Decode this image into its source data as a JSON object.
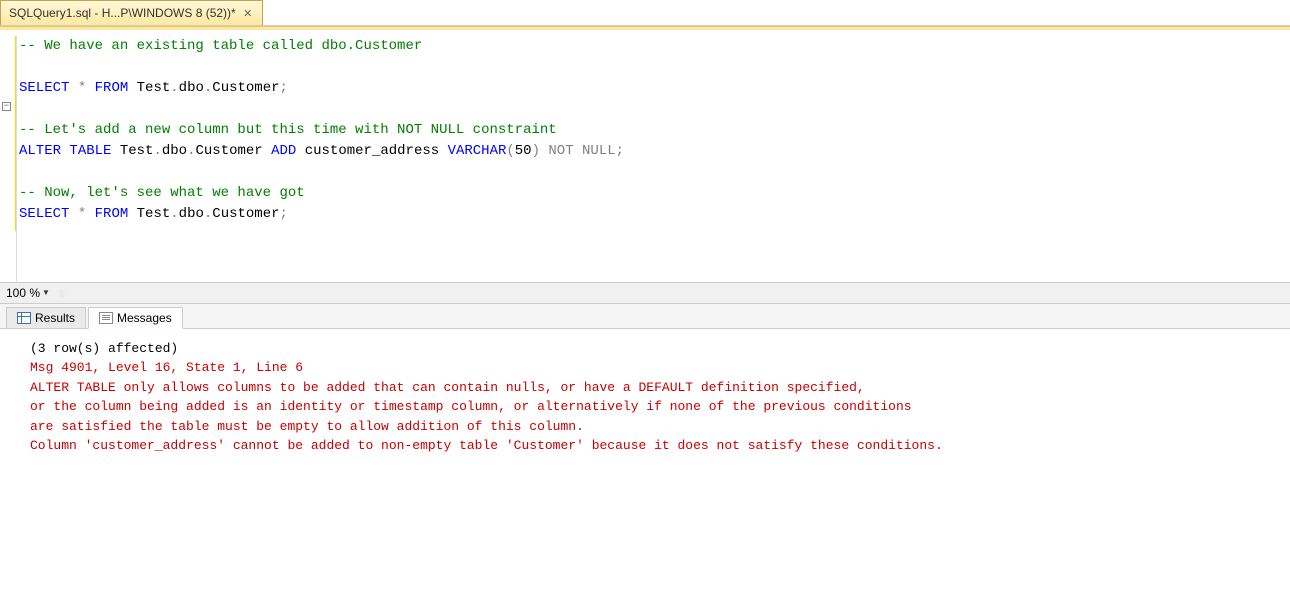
{
  "tab": {
    "title": "SQLQuery1.sql - H...P\\WINDOWS 8 (52))*"
  },
  "editor": {
    "lines": [
      {
        "type": "comment",
        "text": "-- We have an existing table called dbo.Customer"
      },
      {
        "type": "blank",
        "text": ""
      },
      {
        "type": "sql1_a",
        "kw1": "SELECT",
        "star": " * ",
        "kw2": "FROM",
        "rest": " Test",
        "dot1": ".",
        "rest2": "dbo",
        "dot2": ".",
        "rest3": "Customer",
        "semi": ";"
      },
      {
        "type": "blank",
        "text": ""
      },
      {
        "type": "comment",
        "text": "-- Let's add a new column but this time with NOT NULL constraint"
      },
      {
        "type": "alter",
        "kw1": "ALTER",
        "sp1": " ",
        "kw2": "TABLE",
        "rest1": " Test",
        "d1": ".",
        "rest2": "dbo",
        "d2": ".",
        "rest3": "Customer ",
        "kw3": "ADD",
        "rest4": " customer_address ",
        "kw4": "VARCHAR",
        "paren1": "(",
        "num": "50",
        "paren2": ")",
        "sp2": " ",
        "gray1": "NOT",
        "sp3": " ",
        "gray2": "NULL",
        "semi": ";"
      },
      {
        "type": "blank",
        "text": ""
      },
      {
        "type": "comment",
        "text": "-- Now, let's see what we have got"
      },
      {
        "type": "sql1_a",
        "kw1": "SELECT",
        "star": " * ",
        "kw2": "FROM",
        "rest": " Test",
        "dot1": ".",
        "rest2": "dbo",
        "dot2": ".",
        "rest3": "Customer",
        "semi": ";"
      }
    ]
  },
  "zoom": {
    "value": "100 %"
  },
  "resultsTabs": {
    "results": "Results",
    "messages": "Messages"
  },
  "messages": {
    "line1": "(3 row(s) affected)",
    "line2": "Msg 4901, Level 16, State 1, Line 6",
    "line3": "ALTER TABLE only allows columns to be added that can contain nulls, or have a DEFAULT definition specified,",
    "line4": " or the column being added is an identity or timestamp column, or alternatively if none of the previous conditions",
    "line5": " are satisfied the table must be empty to allow addition of this column.",
    "line6": "Column 'customer_address' cannot be added to non-empty table 'Customer' because it does not satisfy these conditions."
  }
}
